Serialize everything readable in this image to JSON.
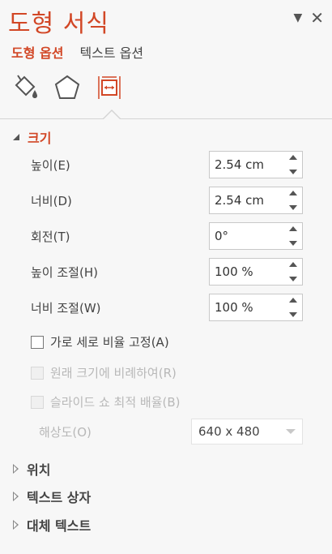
{
  "pane": {
    "title": "도형 서식",
    "options_icon": "chevron-down-icon",
    "close_icon": "close-icon"
  },
  "tabs": [
    {
      "label": "도형 옵션",
      "active": true
    },
    {
      "label": "텍스트 옵션",
      "active": false
    }
  ],
  "category_icons": [
    {
      "icon": "fill-line-icon",
      "selected": false
    },
    {
      "icon": "effects-pentagon-icon",
      "selected": false
    },
    {
      "icon": "size-properties-icon",
      "selected": true
    }
  ],
  "size_section": {
    "title": "크기",
    "expanded": true,
    "fields": [
      {
        "label": "높이(E)",
        "value": "2.54 cm"
      },
      {
        "label": "너비(D)",
        "value": "2.54 cm"
      },
      {
        "label": "회전(T)",
        "value": "0°"
      },
      {
        "label": "높이 조절(H)",
        "value": "100 %"
      },
      {
        "label": "너비 조절(W)",
        "value": "100 %"
      }
    ],
    "checkboxes": [
      {
        "label": "가로 세로 비율 고정(A)",
        "checked": false,
        "enabled": true
      },
      {
        "label": "원래 크기에 비례하여(R)",
        "checked": false,
        "enabled": false
      },
      {
        "label": "슬라이드 쇼 최적 배율(B)",
        "checked": false,
        "enabled": false
      }
    ],
    "resolution": {
      "label": "해상도(O)",
      "value": "640 x 480",
      "enabled": false
    }
  },
  "collapsed_sections": [
    {
      "title": "위치"
    },
    {
      "title": "텍스트 상자"
    },
    {
      "title": "대체 텍스트"
    }
  ],
  "colors": {
    "accent": "#d24726",
    "background": "#f7f7f7",
    "text": "#444444",
    "disabled_text": "#b8b8b8"
  }
}
